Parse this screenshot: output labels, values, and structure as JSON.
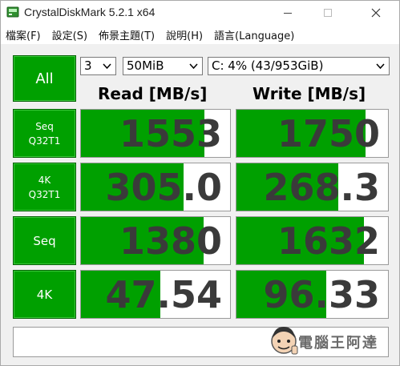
{
  "window": {
    "title": "CrystalDiskMark 5.2.1 x64"
  },
  "menu": {
    "items": [
      {
        "label": "檔案(F)"
      },
      {
        "label": "設定(S)"
      },
      {
        "label": "佈景主題(T)"
      },
      {
        "label": "說明(H)"
      },
      {
        "label": "語言(Language)"
      }
    ]
  },
  "controls": {
    "all_button": "All",
    "test_count": "3",
    "test_size": "50MiB",
    "drive": "C: 4% (43/953GiB)"
  },
  "headers": {
    "read": "Read [MB/s]",
    "write": "Write [MB/s]"
  },
  "tests": [
    {
      "line1": "Seq",
      "line2": "Q32T1",
      "read": "1553",
      "write": "1750",
      "read_fill_pct": 83,
      "write_fill_pct": 85
    },
    {
      "line1": "4K",
      "line2": "Q32T1",
      "read": "305.0",
      "write": "268.3",
      "read_fill_pct": 69,
      "write_fill_pct": 67
    },
    {
      "line1": "Seq",
      "line2": "",
      "read": "1380",
      "write": "1632",
      "read_fill_pct": 82,
      "write_fill_pct": 84
    },
    {
      "line1": "4K",
      "line2": "",
      "read": "47.54",
      "write": "96.33",
      "read_fill_pct": 53,
      "write_fill_pct": 59
    }
  ],
  "comment": "",
  "watermark": {
    "text": "電腦王阿達",
    "color": "#6a6a6a"
  },
  "colors": {
    "bar_green": "#00a000",
    "value_text": "#3a3a3a"
  }
}
